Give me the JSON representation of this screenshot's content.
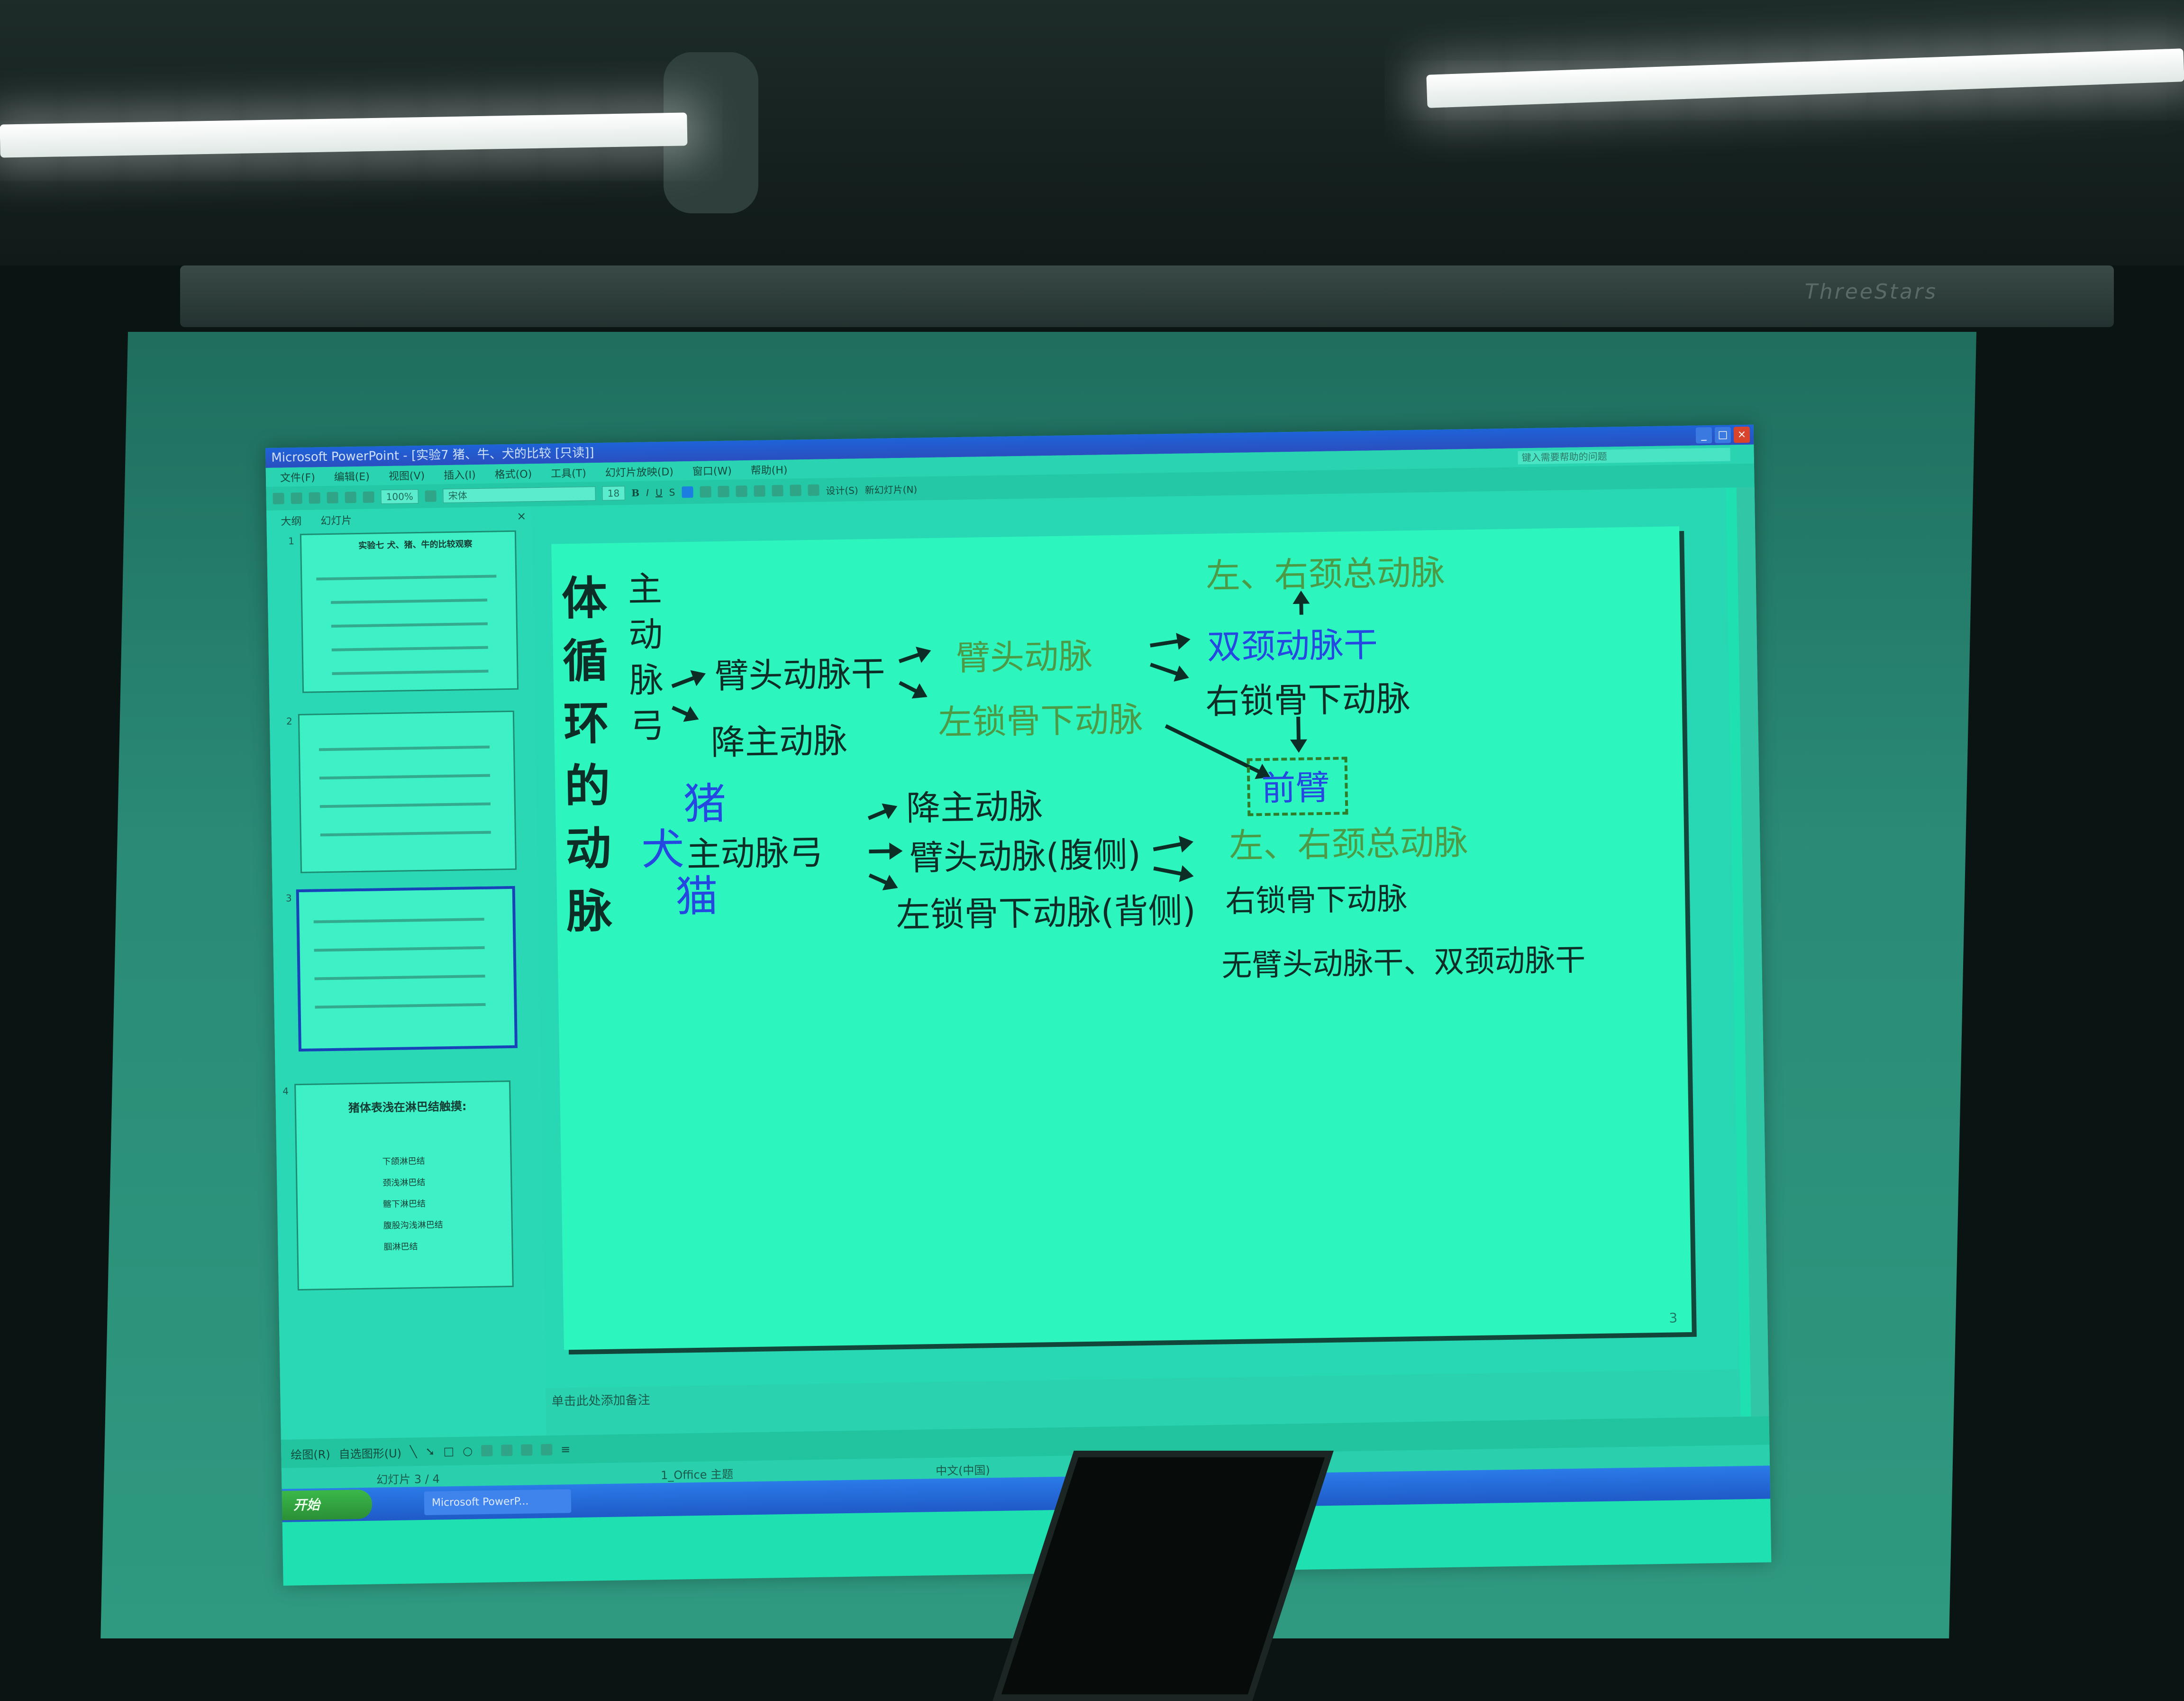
{
  "window": {
    "title": "Microsoft PowerPoint - [实验7 猪、牛、犬的比较 [只读]]",
    "controls": [
      "_",
      "□",
      "×"
    ]
  },
  "menubar": {
    "items": [
      "文件(F)",
      "编辑(E)",
      "视图(V)",
      "插入(I)",
      "格式(O)",
      "工具(T)",
      "幻灯片放映(D)",
      "窗口(W)",
      "帮助(H)"
    ],
    "help_placeholder": "键入需要帮助的问题"
  },
  "toolbar": {
    "zoom": "100%",
    "font": "宋体",
    "size": "18",
    "design": "设计(S)",
    "new_slide": "新幻灯片(N)"
  },
  "left_pane": {
    "tabs": [
      "大纲",
      "幻灯片"
    ],
    "thumbnails": [
      {
        "num": "1",
        "title": "实验七  犬、猪、牛的比较观察"
      },
      {
        "num": "2"
      },
      {
        "num": "3"
      },
      {
        "num": "4",
        "title": "猪体表浅在淋巴结触摸:",
        "items": [
          "下颌淋巴结",
          "颈浅淋巴结",
          "髂下淋巴结",
          "腹股沟浅淋巴结",
          "腘淋巴结"
        ]
      }
    ]
  },
  "slide": {
    "number": "3",
    "title": "体循环的动脉",
    "main": {
      "aortic_arch": "主动脉弓",
      "brachiocephalic_trunk": "臂头动脉干",
      "descending_aorta": "降主动脉",
      "brachiocephalic_artery": "臂头动脉",
      "left_subclavian": "左锁骨下动脉",
      "bicarotid_trunk": "双颈动脉干",
      "right_subclavian": "右锁骨下动脉",
      "carotids": "左、右颈总动脉",
      "forelimb": "前臂"
    },
    "species": {
      "pig": "猪",
      "dog": "犬",
      "cat": "猫"
    },
    "second": {
      "aortic_arch": "主动脉弓",
      "descending_aorta": "降主动脉",
      "brachiocephalic_ventral": "臂头动脉(腹侧)",
      "left_subclavian_dorsal": "左锁骨下动脉(背侧)",
      "carotids": "左、右颈总动脉",
      "right_subclavian": "右锁骨下动脉",
      "note": "无臂头动脉干、双颈动脉干"
    }
  },
  "notes_placeholder": "单击此处添加备注",
  "drawbar": {
    "draw": "绘图(R)",
    "autoshapes": "自选图形(U)"
  },
  "status": {
    "slide_counter": "幻灯片 3 / 4",
    "theme": "1_Office 主题",
    "language": "中文(中国)"
  },
  "taskbar": {
    "start": "开始",
    "item": "Microsoft PowerP..."
  },
  "environment": {
    "screen_brand": "ThreeStars"
  },
  "colors": {
    "slide_bg": "#2df5be",
    "accent_blue": "#2448e0",
    "accent_green": "#4c9a46"
  }
}
